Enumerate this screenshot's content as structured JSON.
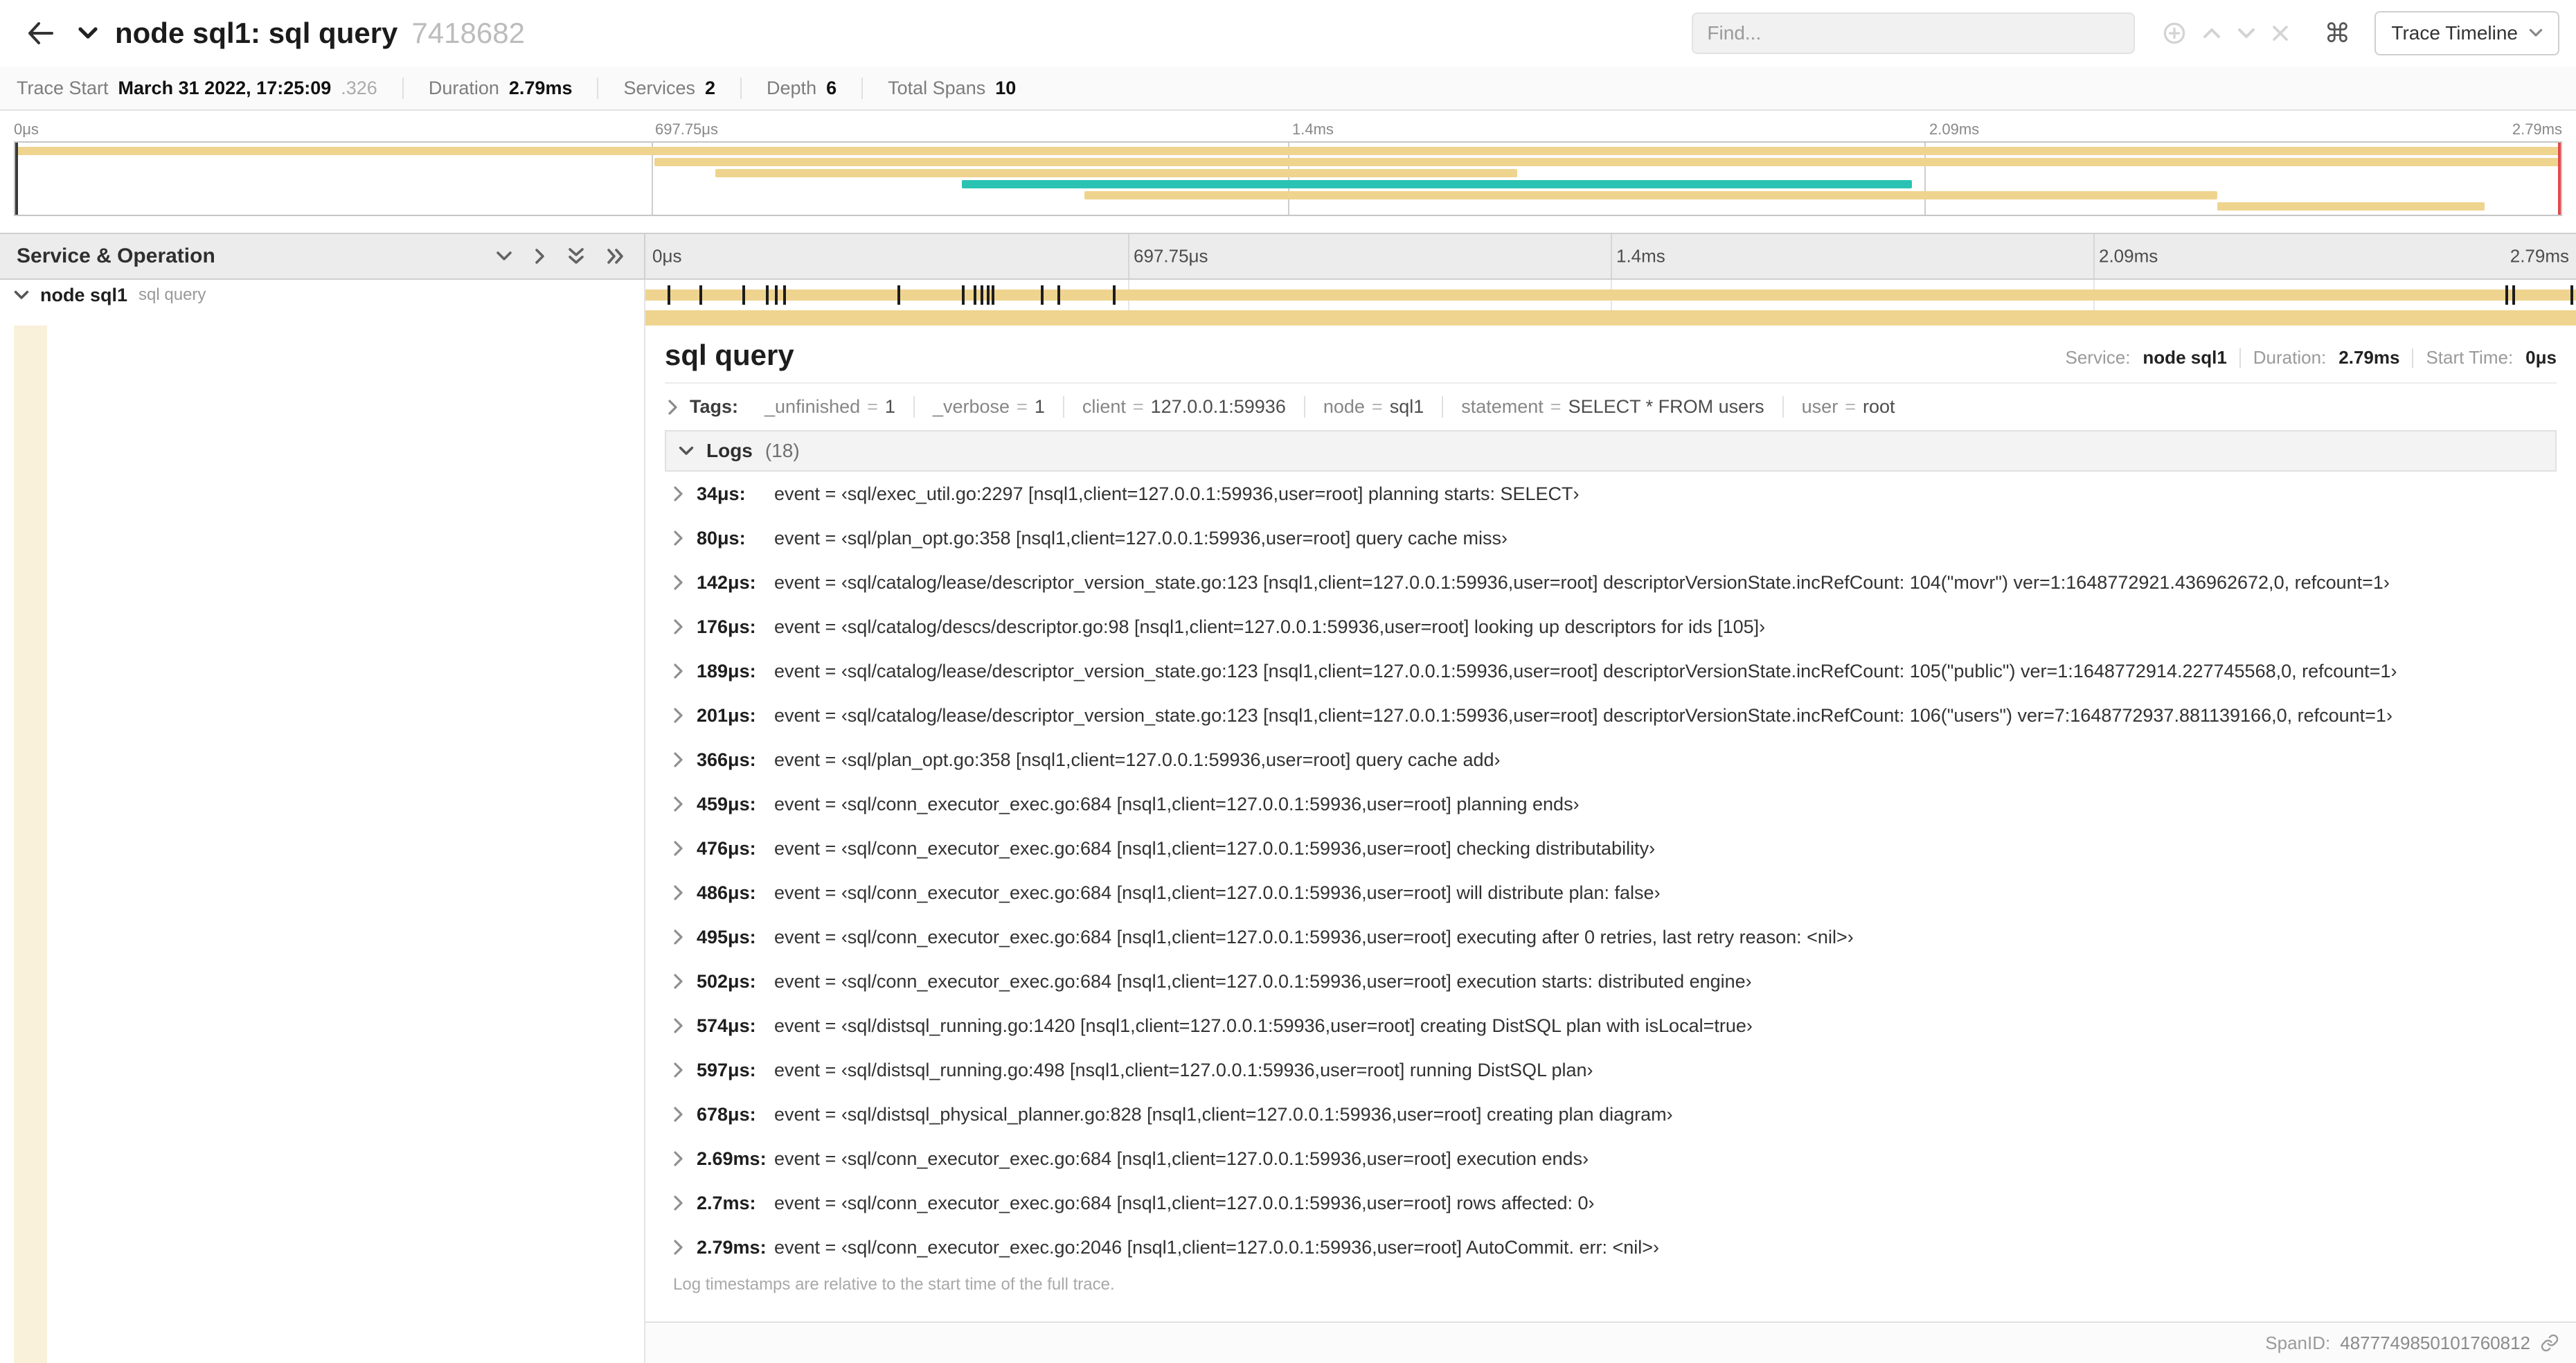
{
  "colors": {
    "tan": "#EFD48F",
    "tan_light": "#FAF1DB",
    "teal": "#2AC3B3",
    "handle_left": "#3a3a3a",
    "handle_right": "#e5484d"
  },
  "header": {
    "title": "node sql1: sql query",
    "trace_id": "7418682",
    "find_placeholder": "Find...",
    "shortcut_symbol": "⌘",
    "view_selector": "Trace Timeline"
  },
  "trace_info": {
    "items": [
      {
        "label": "Trace Start",
        "value": "March 31 2022, 17:25:09",
        "suffix": ".326"
      },
      {
        "label": "Duration",
        "value": "2.79ms"
      },
      {
        "label": "Services",
        "value": "2"
      },
      {
        "label": "Depth",
        "value": "6"
      },
      {
        "label": "Total Spans",
        "value": "10"
      }
    ]
  },
  "minimap": {
    "ticks": [
      "0μs",
      "697.75μs",
      "1.4ms",
      "2.09ms",
      "2.79ms"
    ],
    "tick_positions": [
      0,
      25,
      50,
      75,
      100
    ],
    "gridlines": [
      25,
      50,
      75
    ],
    "spans": [
      {
        "row": 0,
        "start": 0,
        "width": 100,
        "color": "tan"
      },
      {
        "row": 1,
        "start": 25.1,
        "width": 74.9,
        "color": "tan"
      },
      {
        "row": 2,
        "start": 27.5,
        "width": 31.5,
        "color": "tan"
      },
      {
        "row": 3,
        "start": 37.2,
        "width": 37.3,
        "color": "teal"
      },
      {
        "row": 4,
        "start": 42.0,
        "width": 44.5,
        "color": "tan"
      },
      {
        "row": 5,
        "start": 86.5,
        "width": 10.5,
        "color": "tan"
      }
    ]
  },
  "timeline": {
    "left_header": "Service & Operation",
    "ticks": [
      "0μs",
      "697.75μs",
      "1.4ms",
      "2.09ms",
      "2.79ms"
    ],
    "tick_positions": [
      0,
      25,
      50,
      75,
      100
    ],
    "gridlines": [
      25,
      50,
      75
    ],
    "row": {
      "service": "node sql1",
      "operation": "sql query"
    },
    "log_marks": [
      1.22,
      2.87,
      5.09,
      6.31,
      6.77,
      7.2,
      13.12,
      16.45,
      17.06,
      17.42,
      17.74,
      17.99,
      20.57,
      21.4,
      24.3,
      96.42,
      96.77,
      99.8
    ]
  },
  "detail": {
    "title": "sql query",
    "service_label": "Service:",
    "service": "node sql1",
    "duration_label": "Duration:",
    "duration": "2.79ms",
    "start_label": "Start Time:",
    "start": "0μs",
    "tags_label": "Tags:",
    "tags": [
      {
        "key": "_unfinished",
        "value": "1"
      },
      {
        "key": "_verbose",
        "value": "1"
      },
      {
        "key": "client",
        "value": "127.0.0.1:59936"
      },
      {
        "key": "node",
        "value": "sql1"
      },
      {
        "key": "statement",
        "value": "SELECT * FROM users"
      },
      {
        "key": "user",
        "value": "root"
      }
    ],
    "logs_title": "Logs",
    "logs_count": "(18)",
    "logs": [
      {
        "time": "34μs:",
        "text": "event = ‹sql/exec_util.go:2297 [nsql1,client=127.0.0.1:59936,user=root] planning starts: SELECT›"
      },
      {
        "time": "80μs:",
        "text": "event = ‹sql/plan_opt.go:358 [nsql1,client=127.0.0.1:59936,user=root] query cache miss›"
      },
      {
        "time": "142μs:",
        "text": "event = ‹sql/catalog/lease/descriptor_version_state.go:123 [nsql1,client=127.0.0.1:59936,user=root] descriptorVersionState.incRefCount: 104(\"movr\") ver=1:1648772921.436962672,0, refcount=1›"
      },
      {
        "time": "176μs:",
        "text": "event = ‹sql/catalog/descs/descriptor.go:98 [nsql1,client=127.0.0.1:59936,user=root] looking up descriptors for ids [105]›"
      },
      {
        "time": "189μs:",
        "text": "event = ‹sql/catalog/lease/descriptor_version_state.go:123 [nsql1,client=127.0.0.1:59936,user=root] descriptorVersionState.incRefCount: 105(\"public\") ver=1:1648772914.227745568,0, refcount=1›"
      },
      {
        "time": "201μs:",
        "text": "event = ‹sql/catalog/lease/descriptor_version_state.go:123 [nsql1,client=127.0.0.1:59936,user=root] descriptorVersionState.incRefCount: 106(\"users\") ver=7:1648772937.881139166,0, refcount=1›"
      },
      {
        "time": "366μs:",
        "text": "event = ‹sql/plan_opt.go:358 [nsql1,client=127.0.0.1:59936,user=root] query cache add›"
      },
      {
        "time": "459μs:",
        "text": "event = ‹sql/conn_executor_exec.go:684 [nsql1,client=127.0.0.1:59936,user=root] planning ends›"
      },
      {
        "time": "476μs:",
        "text": "event = ‹sql/conn_executor_exec.go:684 [nsql1,client=127.0.0.1:59936,user=root] checking distributability›"
      },
      {
        "time": "486μs:",
        "text": "event = ‹sql/conn_executor_exec.go:684 [nsql1,client=127.0.0.1:59936,user=root] will distribute plan: false›"
      },
      {
        "time": "495μs:",
        "text": "event = ‹sql/conn_executor_exec.go:684 [nsql1,client=127.0.0.1:59936,user=root] executing after 0 retries, last retry reason: <nil>›"
      },
      {
        "time": "502μs:",
        "text": "event = ‹sql/conn_executor_exec.go:684 [nsql1,client=127.0.0.1:59936,user=root] execution starts: distributed engine›"
      },
      {
        "time": "574μs:",
        "text": "event = ‹sql/distsql_running.go:1420 [nsql1,client=127.0.0.1:59936,user=root] creating DistSQL plan with isLocal=true›"
      },
      {
        "time": "597μs:",
        "text": "event = ‹sql/distsql_running.go:498 [nsql1,client=127.0.0.1:59936,user=root] running DistSQL plan›"
      },
      {
        "time": "678μs:",
        "text": "event = ‹sql/distsql_physical_planner.go:828 [nsql1,client=127.0.0.1:59936,user=root] creating plan diagram›"
      },
      {
        "time": "2.69ms:",
        "text": "event = ‹sql/conn_executor_exec.go:684 [nsql1,client=127.0.0.1:59936,user=root] execution ends›"
      },
      {
        "time": "2.7ms:",
        "text": "event = ‹sql/conn_executor_exec.go:684 [nsql1,client=127.0.0.1:59936,user=root] rows affected: 0›"
      },
      {
        "time": "2.79ms:",
        "text": "event = ‹sql/conn_executor_exec.go:2046 [nsql1,client=127.0.0.1:59936,user=root] AutoCommit. err: <nil>›"
      }
    ],
    "footer_note": "Log timestamps are relative to the start time of the full trace.",
    "span_id_label": "SpanID:",
    "span_id": "4877749850101760812"
  }
}
